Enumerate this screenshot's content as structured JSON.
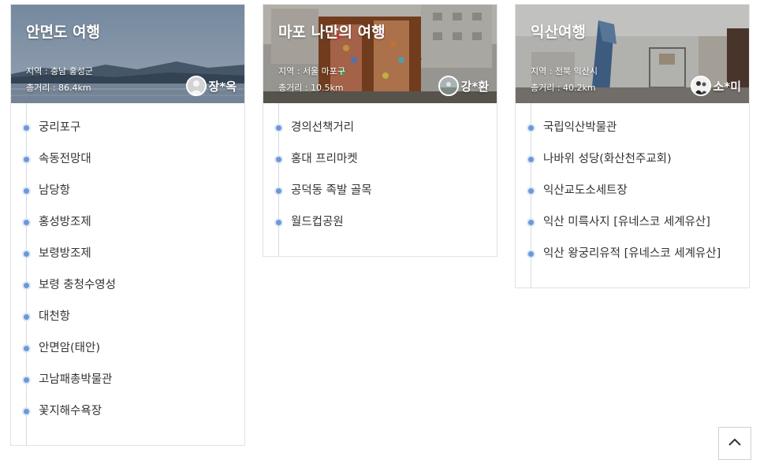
{
  "cards": [
    {
      "title": "안면도 여행",
      "region": "지역 : 충남 홍성군",
      "distance": "총거리 : 86.4km",
      "user": "장*옥",
      "stops": [
        "궁리포구",
        "속동전망대",
        "남당항",
        "홍성방조제",
        "보령방조제",
        "보령 충청수영성",
        "대천항",
        "안면암(태안)",
        "고남패총박물관",
        "꽃지해수욕장"
      ]
    },
    {
      "title": "마포 나만의 여행",
      "region": "지역 : 서울 마포구",
      "distance": "총거리 : 10.5km",
      "user": "강*환",
      "stops": [
        "경의선책거리",
        "홍대 프리마켓",
        "공덕동 족발 골목",
        "월드컵공원"
      ]
    },
    {
      "title": "익산여행",
      "region": "지역 : 전북 익산시",
      "distance": "총거리 : 40.2km",
      "user": "소*미",
      "stops": [
        "국립익산박물관",
        "나바위 성당(화산천주교회)",
        "익산교도소세트장",
        "익산 미륵사지 [유네스코 세계유산]",
        "익산 왕궁리유적 [유네스코 세계유산]"
      ]
    }
  ],
  "colors": {
    "dot": "#6b98d6",
    "line": "#d7dbe3",
    "border": "#e2e2e2"
  },
  "scroll_top_icon": "chevron-up-icon"
}
